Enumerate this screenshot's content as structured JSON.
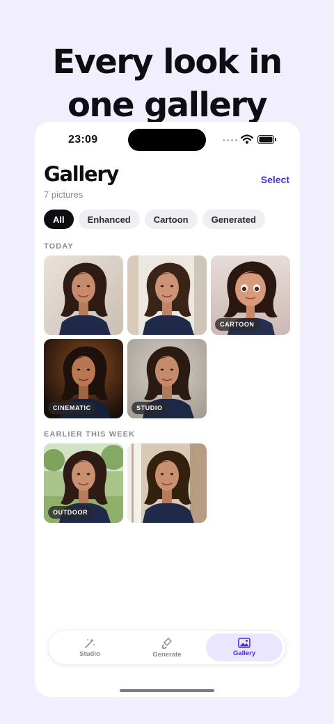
{
  "headline": {
    "line1": "Every look in",
    "line2": "one gallery"
  },
  "status_bar": {
    "time": "23:09",
    "icons": [
      "signal-dots-icon",
      "wifi-icon",
      "battery-icon"
    ]
  },
  "header": {
    "title": "Gallery",
    "count": "7 pictures",
    "select_label": "Select"
  },
  "filters": [
    {
      "label": "All",
      "active": true
    },
    {
      "label": "Enhanced",
      "active": false
    },
    {
      "label": "Cartoon",
      "active": false
    },
    {
      "label": "Generated",
      "active": false
    }
  ],
  "sections": {
    "today": {
      "label": "TODAY",
      "photos": [
        {
          "tag": "",
          "style": "original"
        },
        {
          "tag": "",
          "style": "enhanced"
        },
        {
          "tag": "CARTOON",
          "style": "cartoon"
        },
        {
          "tag": "CINEMATIC",
          "style": "cinematic"
        },
        {
          "tag": "STUDIO",
          "style": "studio"
        }
      ]
    },
    "earlier": {
      "label": "EARLIER THIS WEEK",
      "photos": [
        {
          "tag": "OUTDOOR",
          "style": "outdoor"
        },
        {
          "tag": "",
          "style": "window"
        }
      ]
    }
  },
  "tabbar": {
    "tabs": [
      {
        "label": "Studio",
        "icon": "magic-wand-icon",
        "active": false
      },
      {
        "label": "Generate",
        "icon": "paintbrush-icon",
        "active": false
      },
      {
        "label": "Gallery",
        "icon": "image-icon",
        "active": true
      }
    ]
  },
  "colors": {
    "accent": "#4b2ccf",
    "background": "#f1effd",
    "chip_active": "#0d0d12"
  }
}
